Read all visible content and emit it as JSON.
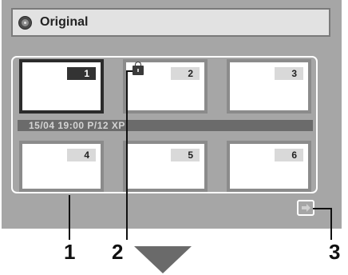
{
  "header": {
    "title": "Original",
    "icon": "disc-icon"
  },
  "thumbnails": [
    {
      "number": "1",
      "selected": true
    },
    {
      "number": "2",
      "selected": false,
      "protected": true
    },
    {
      "number": "3",
      "selected": false
    },
    {
      "number": "4",
      "selected": false
    },
    {
      "number": "5",
      "selected": false
    },
    {
      "number": "6",
      "selected": false
    }
  ],
  "info": {
    "text": "15/04  19:00  P/12  XP"
  },
  "callouts": [
    "1",
    "2",
    "3"
  ],
  "icons": {
    "protect": "lock-icon",
    "next_page": "arrow-right-icon",
    "indicator": "down-arrow-icon"
  }
}
